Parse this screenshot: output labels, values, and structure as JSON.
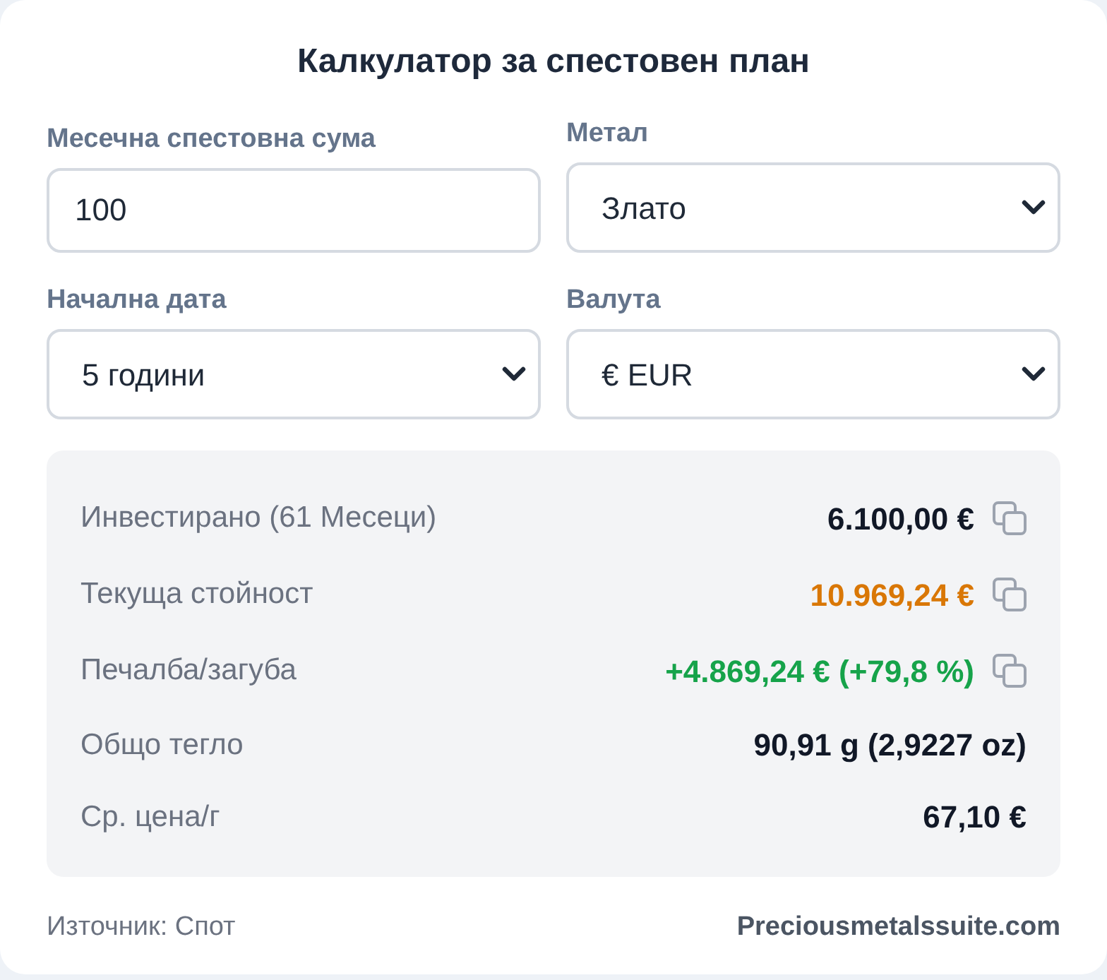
{
  "title": "Калкулатор за спестовен план",
  "fields": [
    {
      "kind": "input",
      "label": "Месечна спестовна сума",
      "value": "100"
    },
    {
      "kind": "select",
      "label": "Метал",
      "value": "Злато"
    },
    {
      "kind": "select",
      "label": "Начална дата",
      "value": "5 години"
    },
    {
      "kind": "select",
      "label": "Валута",
      "value": "€ EUR"
    }
  ],
  "results": [
    {
      "label": "Инвестирано (61 Месеци)",
      "value": "6.100,00 €",
      "color": "#111827",
      "copyable": true
    },
    {
      "label": "Текуща стойност",
      "value": "10.969,24 €",
      "color": "#d97706",
      "copyable": true
    },
    {
      "label": "Печалба/загуба",
      "value": "+4.869,24 € (+79,8 %)",
      "color": "#16a34a",
      "copyable": true
    },
    {
      "label": "Общо тегло",
      "value": "90,91 g (2,9227 oz)",
      "color": "#111827",
      "copyable": false
    },
    {
      "label": "Ср. цена/г",
      "value": "67,10 €",
      "color": "#111827",
      "copyable": false
    }
  ],
  "footer": {
    "source": "Източник: Спот",
    "brand": "Preciousmetalssuite.com"
  }
}
